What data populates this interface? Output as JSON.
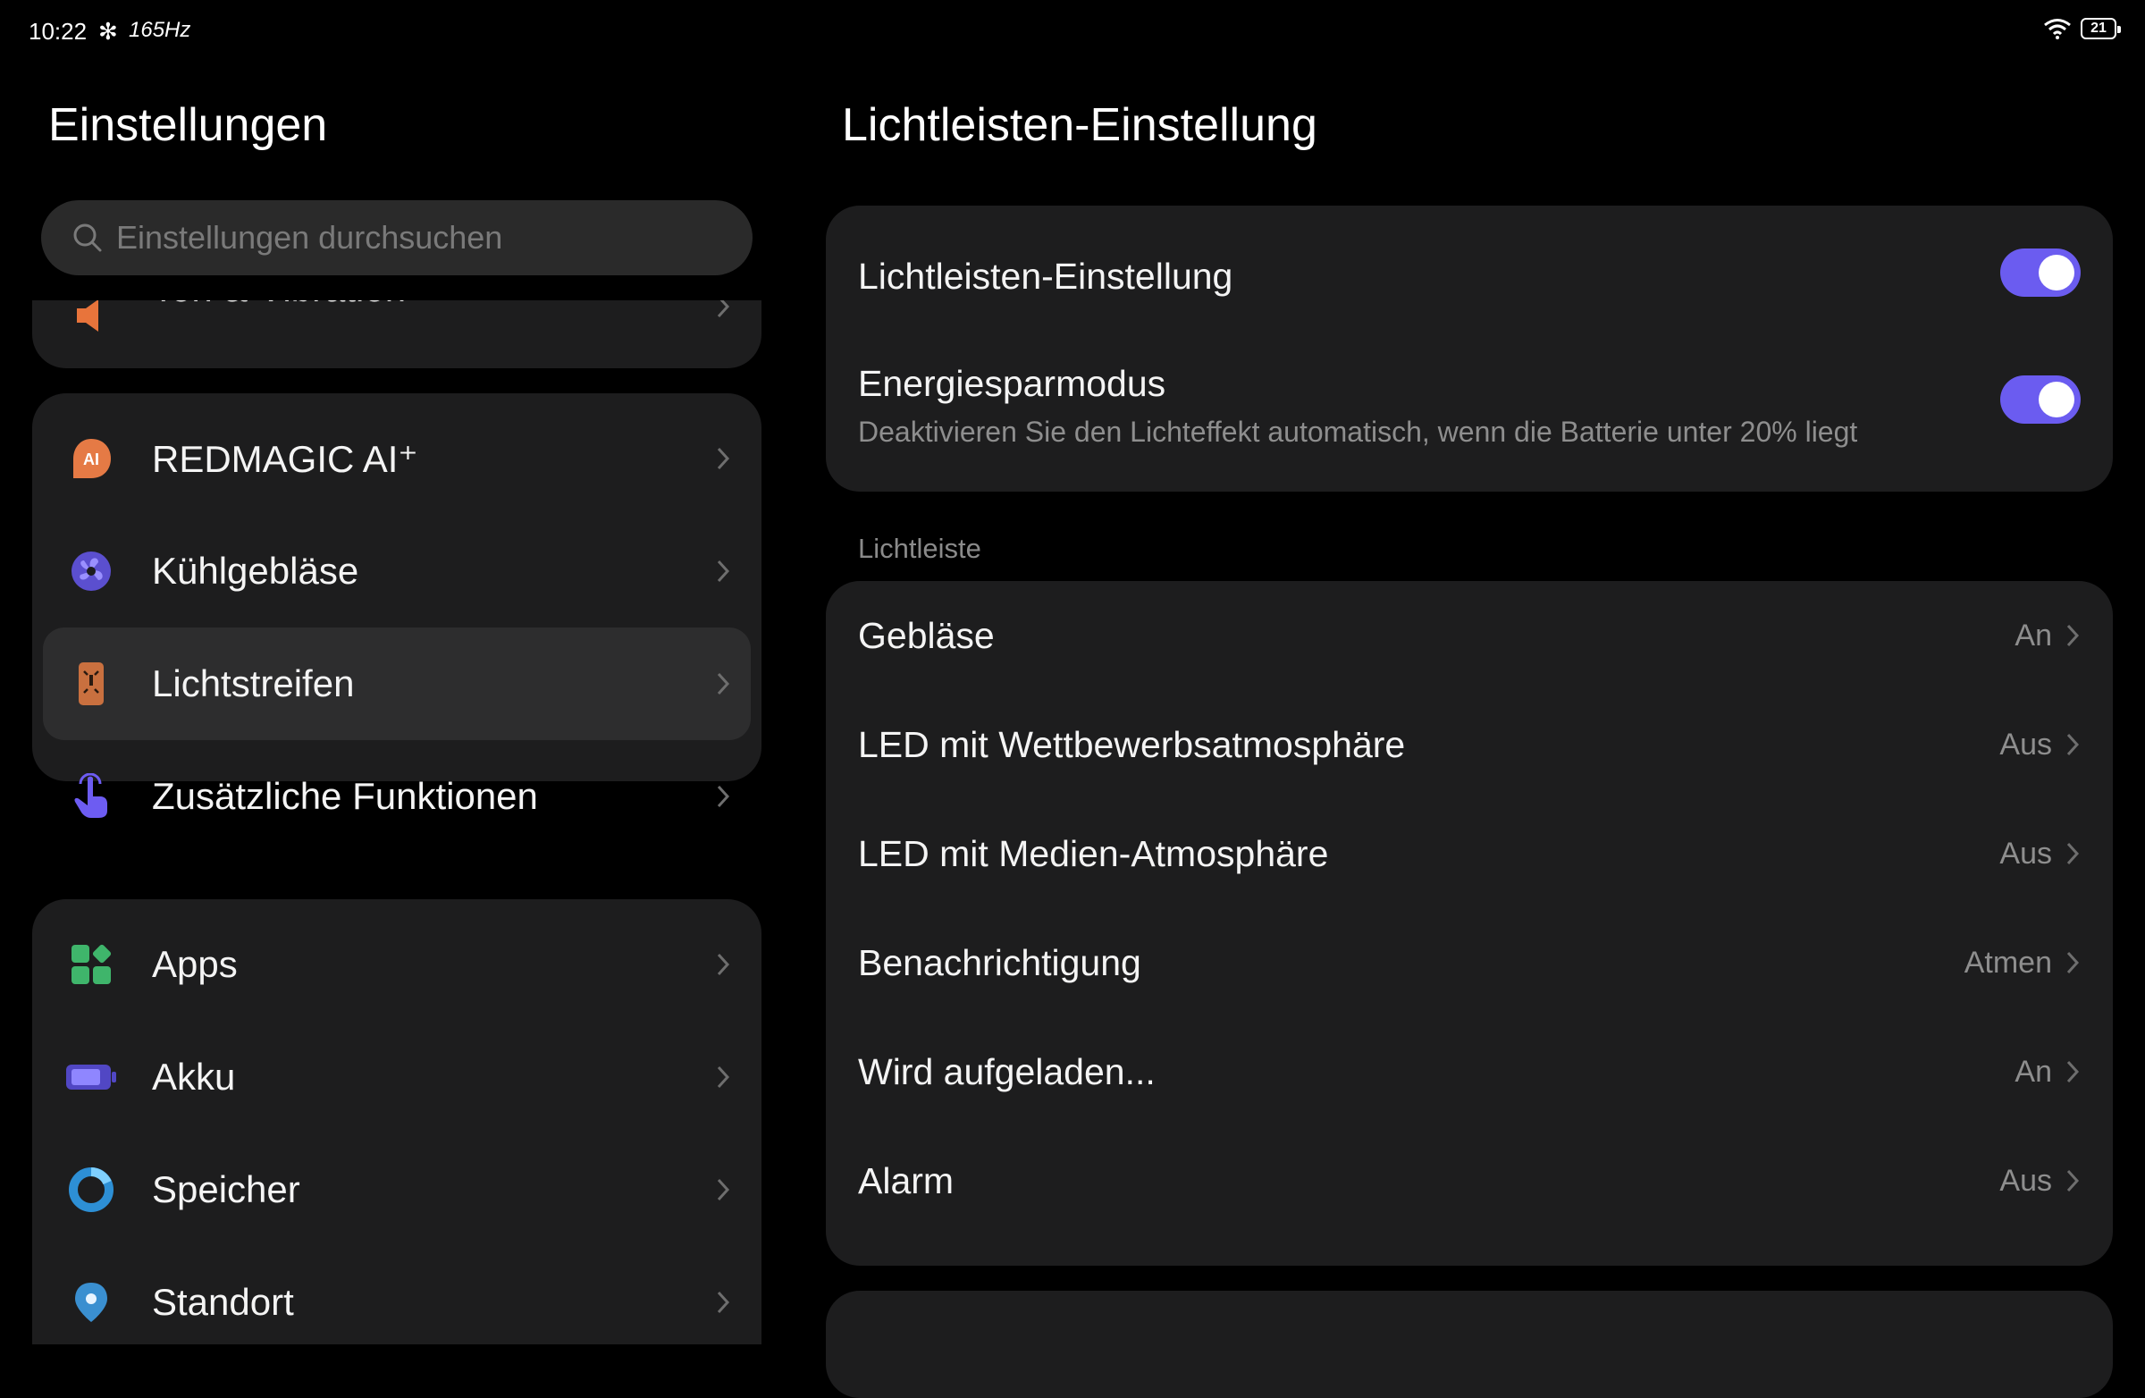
{
  "status_bar": {
    "time": "10:22",
    "refresh_rate": "165Hz",
    "battery": "21"
  },
  "left": {
    "title": "Einstellungen",
    "search_placeholder": "Einstellungen durchsuchen",
    "partial_item": "Ton & Vibration",
    "group1": [
      {
        "label": "REDMAGIC AI⁺",
        "icon": "redmagic-ai-icon"
      },
      {
        "label": "Kühlgebläse",
        "icon": "cooling-fan-icon"
      },
      {
        "label": "Lichtstreifen",
        "icon": "light-strip-icon"
      },
      {
        "label": "Zusätzliche Funktionen",
        "icon": "hand-gesture-icon"
      }
    ],
    "group2": [
      {
        "label": "Apps",
        "icon": "apps-icon"
      },
      {
        "label": "Akku",
        "icon": "battery-icon"
      },
      {
        "label": "Speicher",
        "icon": "storage-icon"
      },
      {
        "label": "Standort",
        "icon": "location-icon"
      }
    ]
  },
  "right": {
    "title": "Lichtleisten-Einstellung",
    "toggles": [
      {
        "title": "Lichtleisten-Einstellung",
        "subtitle": "",
        "on": true
      },
      {
        "title": "Energiesparmodus",
        "subtitle": "Deaktivieren Sie den Lichteffekt automatisch, wenn die Batterie unter 20% liegt",
        "on": true
      }
    ],
    "section_label": "Lichtleiste",
    "items": [
      {
        "title": "Gebläse",
        "value": "An"
      },
      {
        "title": "LED mit Wettbewerbsatmosphäre",
        "value": "Aus"
      },
      {
        "title": "LED mit Medien-Atmosphäre",
        "value": "Aus"
      },
      {
        "title": "Benachrichtigung",
        "value": "Atmen"
      },
      {
        "title": "Wird aufgeladen...",
        "value": "An"
      },
      {
        "title": "Alarm",
        "value": "Aus"
      }
    ]
  },
  "colors": {
    "accent": "#6b5cf0",
    "card": "#1d1d1e",
    "background": "#000000"
  }
}
